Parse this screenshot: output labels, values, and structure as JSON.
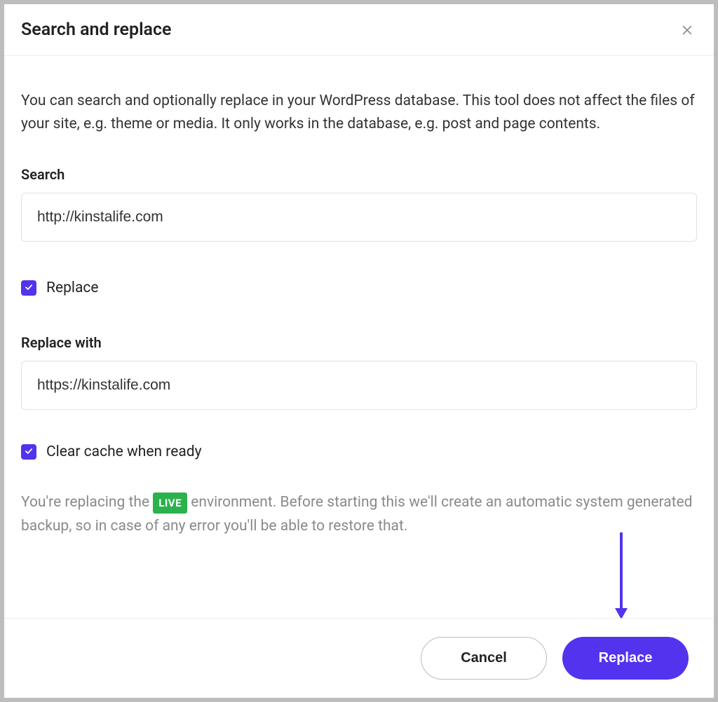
{
  "modal": {
    "title": "Search and replace",
    "description": "You can search and optionally replace in your WordPress database. This tool does not affect the files of your site, e.g. theme or media. It only works in the database, e.g. post and page contents.",
    "search_label": "Search",
    "search_value": "http://kinstalife.com",
    "replace_checkbox_label": "Replace",
    "replace_checked": true,
    "replace_with_label": "Replace with",
    "replace_with_value": "https://kinstalife.com",
    "clear_cache_label": "Clear cache when ready",
    "clear_cache_checked": true,
    "notice_prefix": "You're replacing the ",
    "notice_badge": "LIVE",
    "notice_suffix": " environment. Before starting this we'll create an automatic system generated backup, so in case of any error you'll be able to restore that."
  },
  "footer": {
    "cancel_label": "Cancel",
    "replace_label": "Replace"
  },
  "colors": {
    "primary": "#5333ed",
    "live_badge": "#2bb24c"
  }
}
